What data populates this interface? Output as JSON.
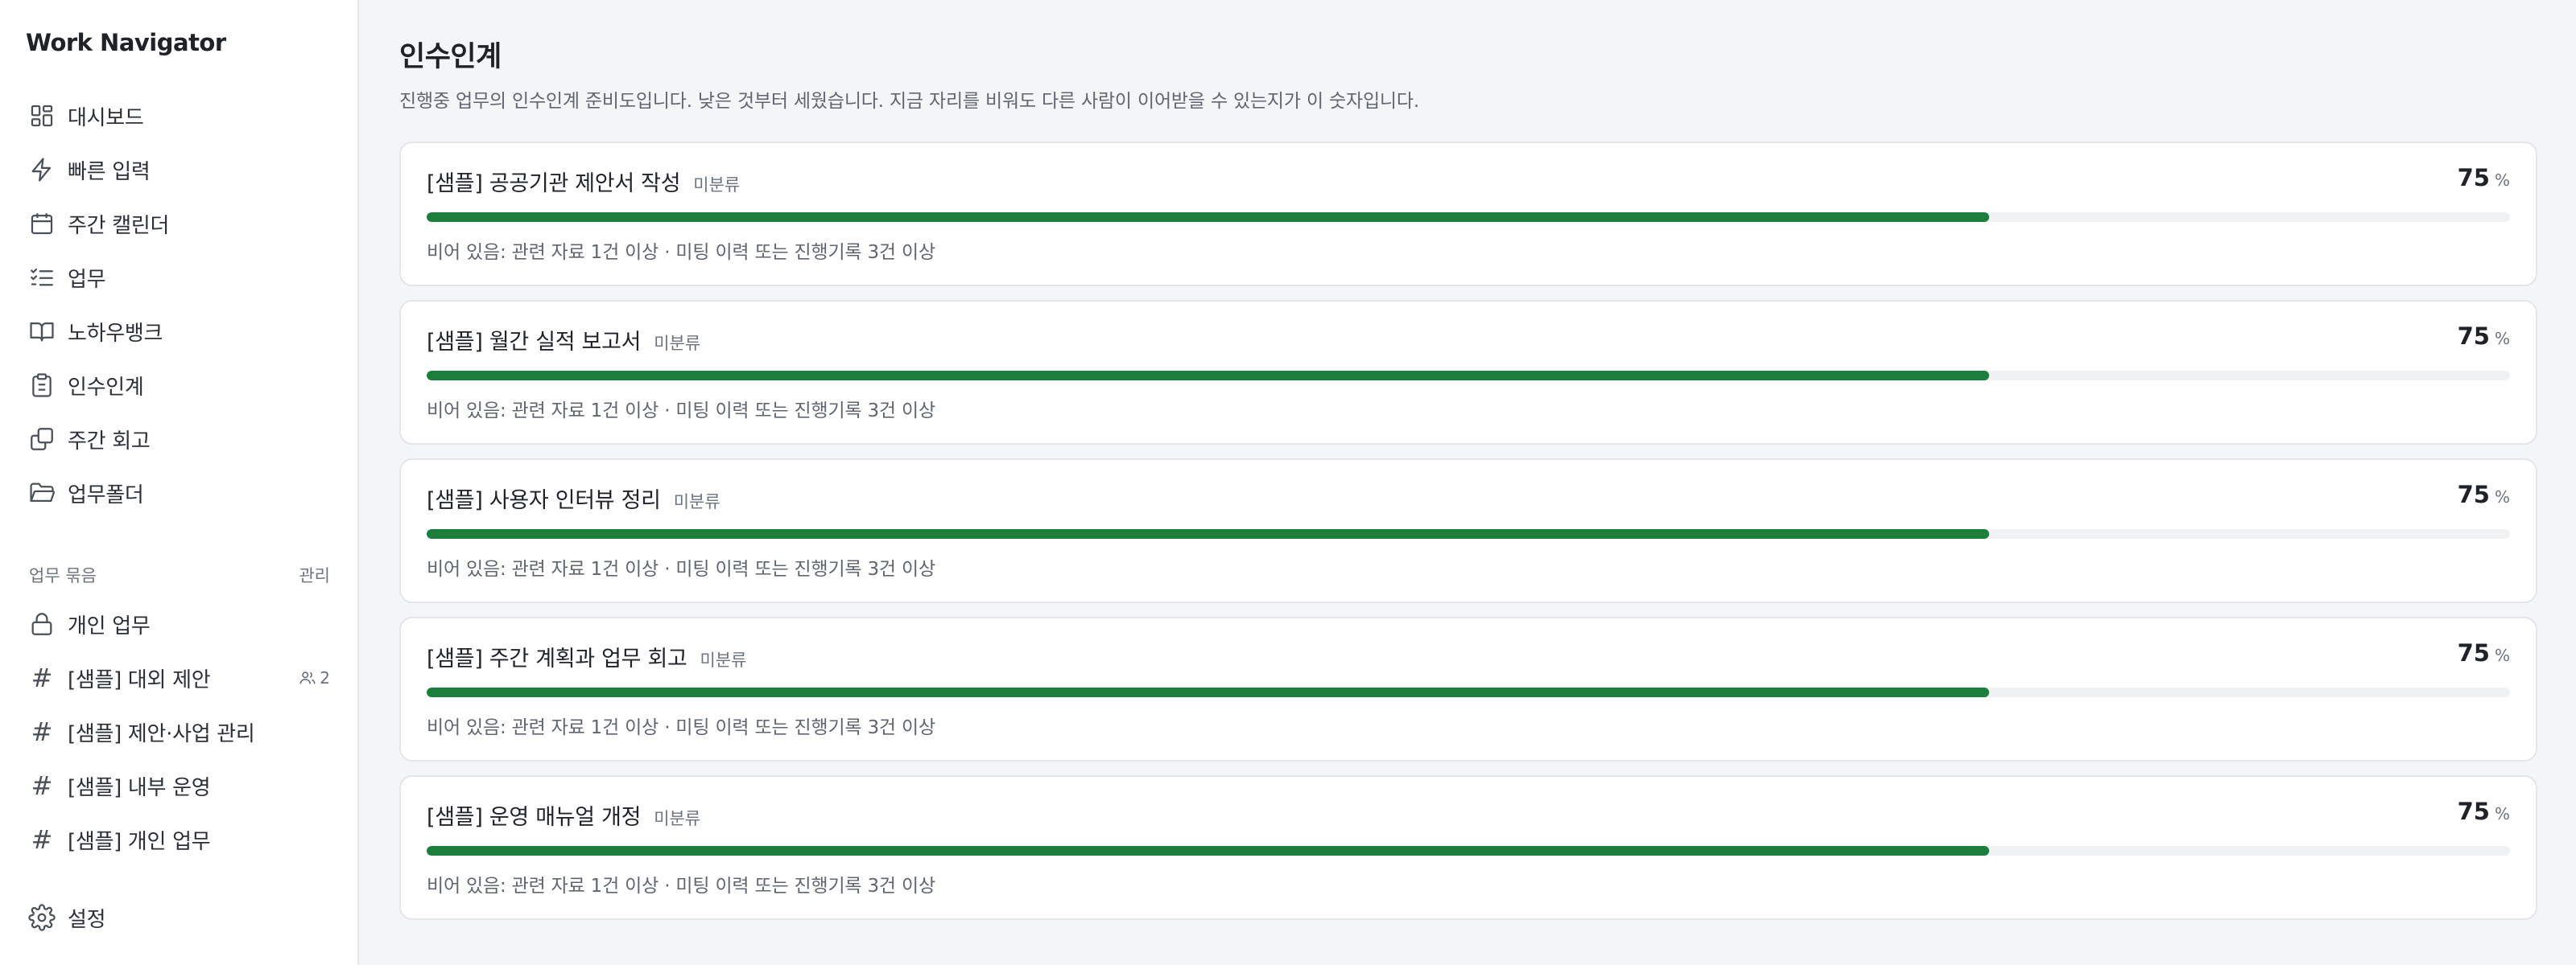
{
  "app": {
    "title": "Work Navigator"
  },
  "sidebar": {
    "nav": [
      {
        "label": "대시보드",
        "icon": "dashboard-icon"
      },
      {
        "label": "빠른 입력",
        "icon": "lightning-icon"
      },
      {
        "label": "주간 캘린더",
        "icon": "calendar-icon"
      },
      {
        "label": "업무",
        "icon": "checklist-icon"
      },
      {
        "label": "노하우뱅크",
        "icon": "book-icon"
      },
      {
        "label": "인수인계",
        "icon": "clipboard-icon"
      },
      {
        "label": "주간 회고",
        "icon": "copy-icon"
      },
      {
        "label": "업무폴더",
        "icon": "folder-icon"
      }
    ],
    "section": {
      "title": "업무 묶음",
      "manage_label": "관리"
    },
    "groups": [
      {
        "label": "개인 업무",
        "icon": "lock-icon"
      },
      {
        "label": "[샘플] 대외 제안",
        "icon": "hash-icon",
        "members": "2"
      },
      {
        "label": "[샘플] 제안·사업 관리",
        "icon": "hash-icon"
      },
      {
        "label": "[샘플] 내부 운영",
        "icon": "hash-icon"
      },
      {
        "label": "[샘플] 개인 업무",
        "icon": "hash-icon"
      }
    ],
    "settings": {
      "label": "설정",
      "icon": "gear-icon"
    }
  },
  "page": {
    "title": "인수인계",
    "description": "진행중 업무의 인수인계 준비도입니다. 낮은 것부터 세웠습니다. 지금 자리를 비워도 다른 사람이 이어받을 수 있는지가 이 숫자입니다."
  },
  "handover_items": [
    {
      "title": "[샘플] 공공기관 제안서 작성",
      "category": "미분류",
      "percent": "75",
      "unit": "%",
      "progress": 0.75,
      "missing": "비어 있음: 관련 자료 1건 이상 · 미팅 이력 또는 진행기록 3건 이상"
    },
    {
      "title": "[샘플] 월간 실적 보고서",
      "category": "미분류",
      "percent": "75",
      "unit": "%",
      "progress": 0.75,
      "missing": "비어 있음: 관련 자료 1건 이상 · 미팅 이력 또는 진행기록 3건 이상"
    },
    {
      "title": "[샘플] 사용자 인터뷰 정리",
      "category": "미분류",
      "percent": "75",
      "unit": "%",
      "progress": 0.75,
      "missing": "비어 있음: 관련 자료 1건 이상 · 미팅 이력 또는 진행기록 3건 이상"
    },
    {
      "title": "[샘플] 주간 계획과 업무 회고",
      "category": "미분류",
      "percent": "75",
      "unit": "%",
      "progress": 0.75,
      "missing": "비어 있음: 관련 자료 1건 이상 · 미팅 이력 또는 진행기록 3건 이상"
    },
    {
      "title": "[샘플] 운영 매뉴얼 개정",
      "category": "미분류",
      "percent": "75",
      "unit": "%",
      "progress": 0.75,
      "missing": "비어 있음: 관련 자료 1건 이상 · 미팅 이력 또는 진행기록 3건 이상"
    }
  ],
  "colors": {
    "progress_fill": "#1b7f3b",
    "progress_track": "#f0f1f3",
    "background": "#f4f5f7"
  }
}
